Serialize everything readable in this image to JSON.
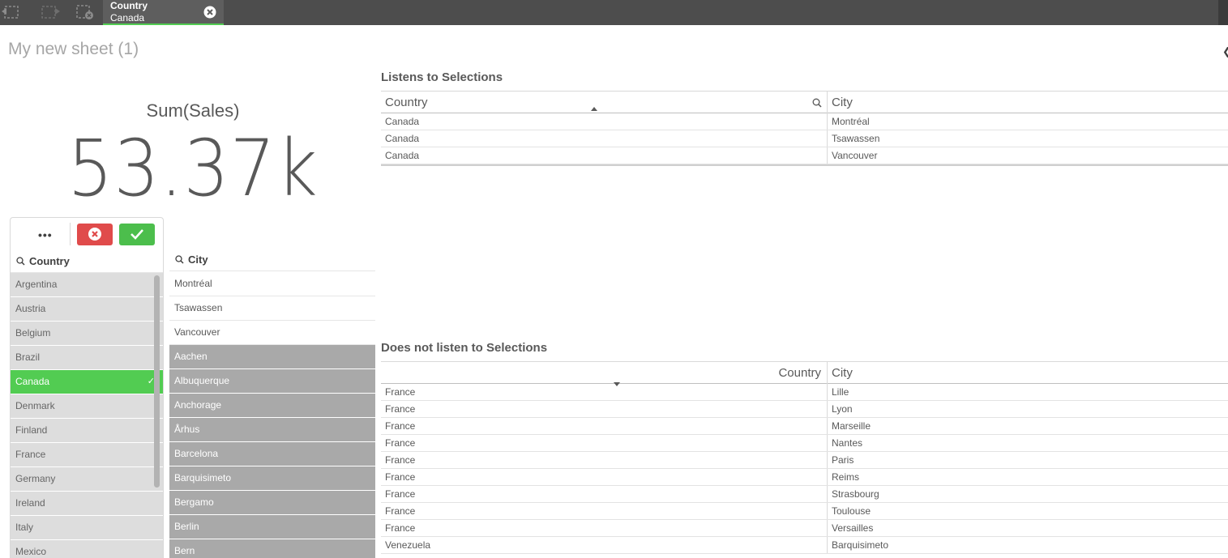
{
  "toolbar": {
    "back_icon": "step-back-icon",
    "forward_icon": "step-forward-icon",
    "clear_icon": "clear-all-selections-icon",
    "selection": {
      "field": "Country",
      "value": "Canada"
    }
  },
  "sheet": {
    "title": "My new sheet (1)"
  },
  "kpi": {
    "label": "Sum(Sales)",
    "value": "53.37k"
  },
  "country_pane": {
    "more_label": "•••",
    "header": "Country",
    "items": [
      {
        "label": "Argentina",
        "state": "alternative"
      },
      {
        "label": "Austria",
        "state": "alternative"
      },
      {
        "label": "Belgium",
        "state": "alternative"
      },
      {
        "label": "Brazil",
        "state": "alternative"
      },
      {
        "label": "Canada",
        "state": "selected"
      },
      {
        "label": "Denmark",
        "state": "alternative"
      },
      {
        "label": "Finland",
        "state": "alternative"
      },
      {
        "label": "France",
        "state": "alternative"
      },
      {
        "label": "Germany",
        "state": "alternative"
      },
      {
        "label": "Ireland",
        "state": "alternative"
      },
      {
        "label": "Italy",
        "state": "alternative"
      },
      {
        "label": "Mexico",
        "state": "alternative"
      }
    ]
  },
  "city_pane": {
    "header": "City",
    "items": [
      {
        "label": "Montréal",
        "state": "possible"
      },
      {
        "label": "Tsawassen",
        "state": "possible"
      },
      {
        "label": "Vancouver",
        "state": "possible"
      },
      {
        "label": "Aachen",
        "state": "excluded"
      },
      {
        "label": "Albuquerque",
        "state": "excluded"
      },
      {
        "label": "Anchorage",
        "state": "excluded"
      },
      {
        "label": "Århus",
        "state": "excluded"
      },
      {
        "label": "Barcelona",
        "state": "excluded"
      },
      {
        "label": "Barquisimeto",
        "state": "excluded"
      },
      {
        "label": "Bergamo",
        "state": "excluded"
      },
      {
        "label": "Berlin",
        "state": "excluded"
      },
      {
        "label": "Bern",
        "state": "excluded"
      }
    ]
  },
  "table_listens": {
    "title": "Listens to Selections",
    "columns": [
      "Country",
      "City"
    ],
    "rows": [
      [
        "Canada",
        "Montréal"
      ],
      [
        "Canada",
        "Tsawassen"
      ],
      [
        "Canada",
        "Vancouver"
      ]
    ]
  },
  "table_static": {
    "title": "Does not listen to Selections",
    "columns": [
      "Country",
      "City"
    ],
    "rows": [
      [
        "France",
        "Lille"
      ],
      [
        "France",
        "Lyon"
      ],
      [
        "France",
        "Marseille"
      ],
      [
        "France",
        "Nantes"
      ],
      [
        "France",
        "Paris"
      ],
      [
        "France",
        "Reims"
      ],
      [
        "France",
        "Strasbourg"
      ],
      [
        "France",
        "Toulouse"
      ],
      [
        "France",
        "Versailles"
      ],
      [
        "Venezuela",
        "Barquisimeto"
      ]
    ]
  },
  "colors": {
    "selected": "#52cc52",
    "alternative": "#dddddd",
    "excluded": "#a9a9a9",
    "cancel": "#e04b4b",
    "confirm": "#4cbe4c",
    "toolbar_bg": "#4d4d4d"
  }
}
